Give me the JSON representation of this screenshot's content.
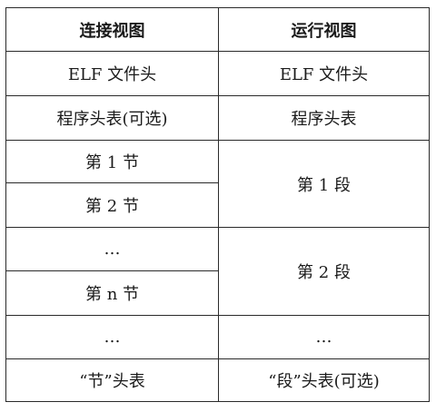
{
  "table": {
    "headers": {
      "link_view": "连接视图",
      "run_view": "运行视图"
    },
    "link_view_cells": [
      "ELF 文件头",
      "程序头表(可选)",
      "第 1 节",
      "第 2 节",
      "…",
      "第 n 节",
      "…",
      "“节”头表"
    ],
    "run_view_cells": [
      "ELF 文件头",
      "程序头表",
      "第 1 段",
      "第 2 段",
      "…",
      "“段”头表(可选)"
    ]
  }
}
